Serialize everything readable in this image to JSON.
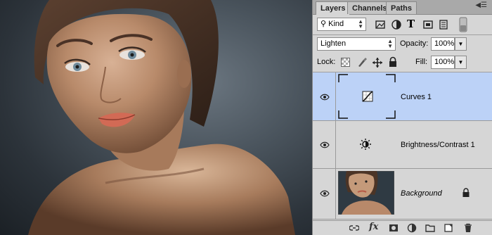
{
  "tabs": [
    {
      "label": "Layers"
    },
    {
      "label": "Channels"
    },
    {
      "label": "Paths"
    }
  ],
  "filter": {
    "kind_label": "Kind"
  },
  "blend": {
    "mode": "Lighten",
    "opacity_label": "Opacity:",
    "opacity_value": "100%"
  },
  "lock": {
    "label": "Lock:",
    "fill_label": "Fill:",
    "fill_value": "100%"
  },
  "layers": [
    {
      "name": "Curves 1",
      "icon": "curves-icon",
      "selected": true
    },
    {
      "name": "Brightness/Contrast 1",
      "icon": "brightness-contrast-icon",
      "selected": false
    },
    {
      "name": "Background",
      "icon": "photo-thumbnail",
      "selected": false,
      "locked": true
    }
  ],
  "bottom_icons": [
    "link-layers-icon",
    "fx-icon",
    "add-mask-icon",
    "adjustment-layer-icon",
    "new-group-icon",
    "new-layer-icon",
    "delete-layer-icon"
  ],
  "colors": {
    "selection": "#bcd2f7",
    "panel_bg": "#d6d6d6"
  }
}
